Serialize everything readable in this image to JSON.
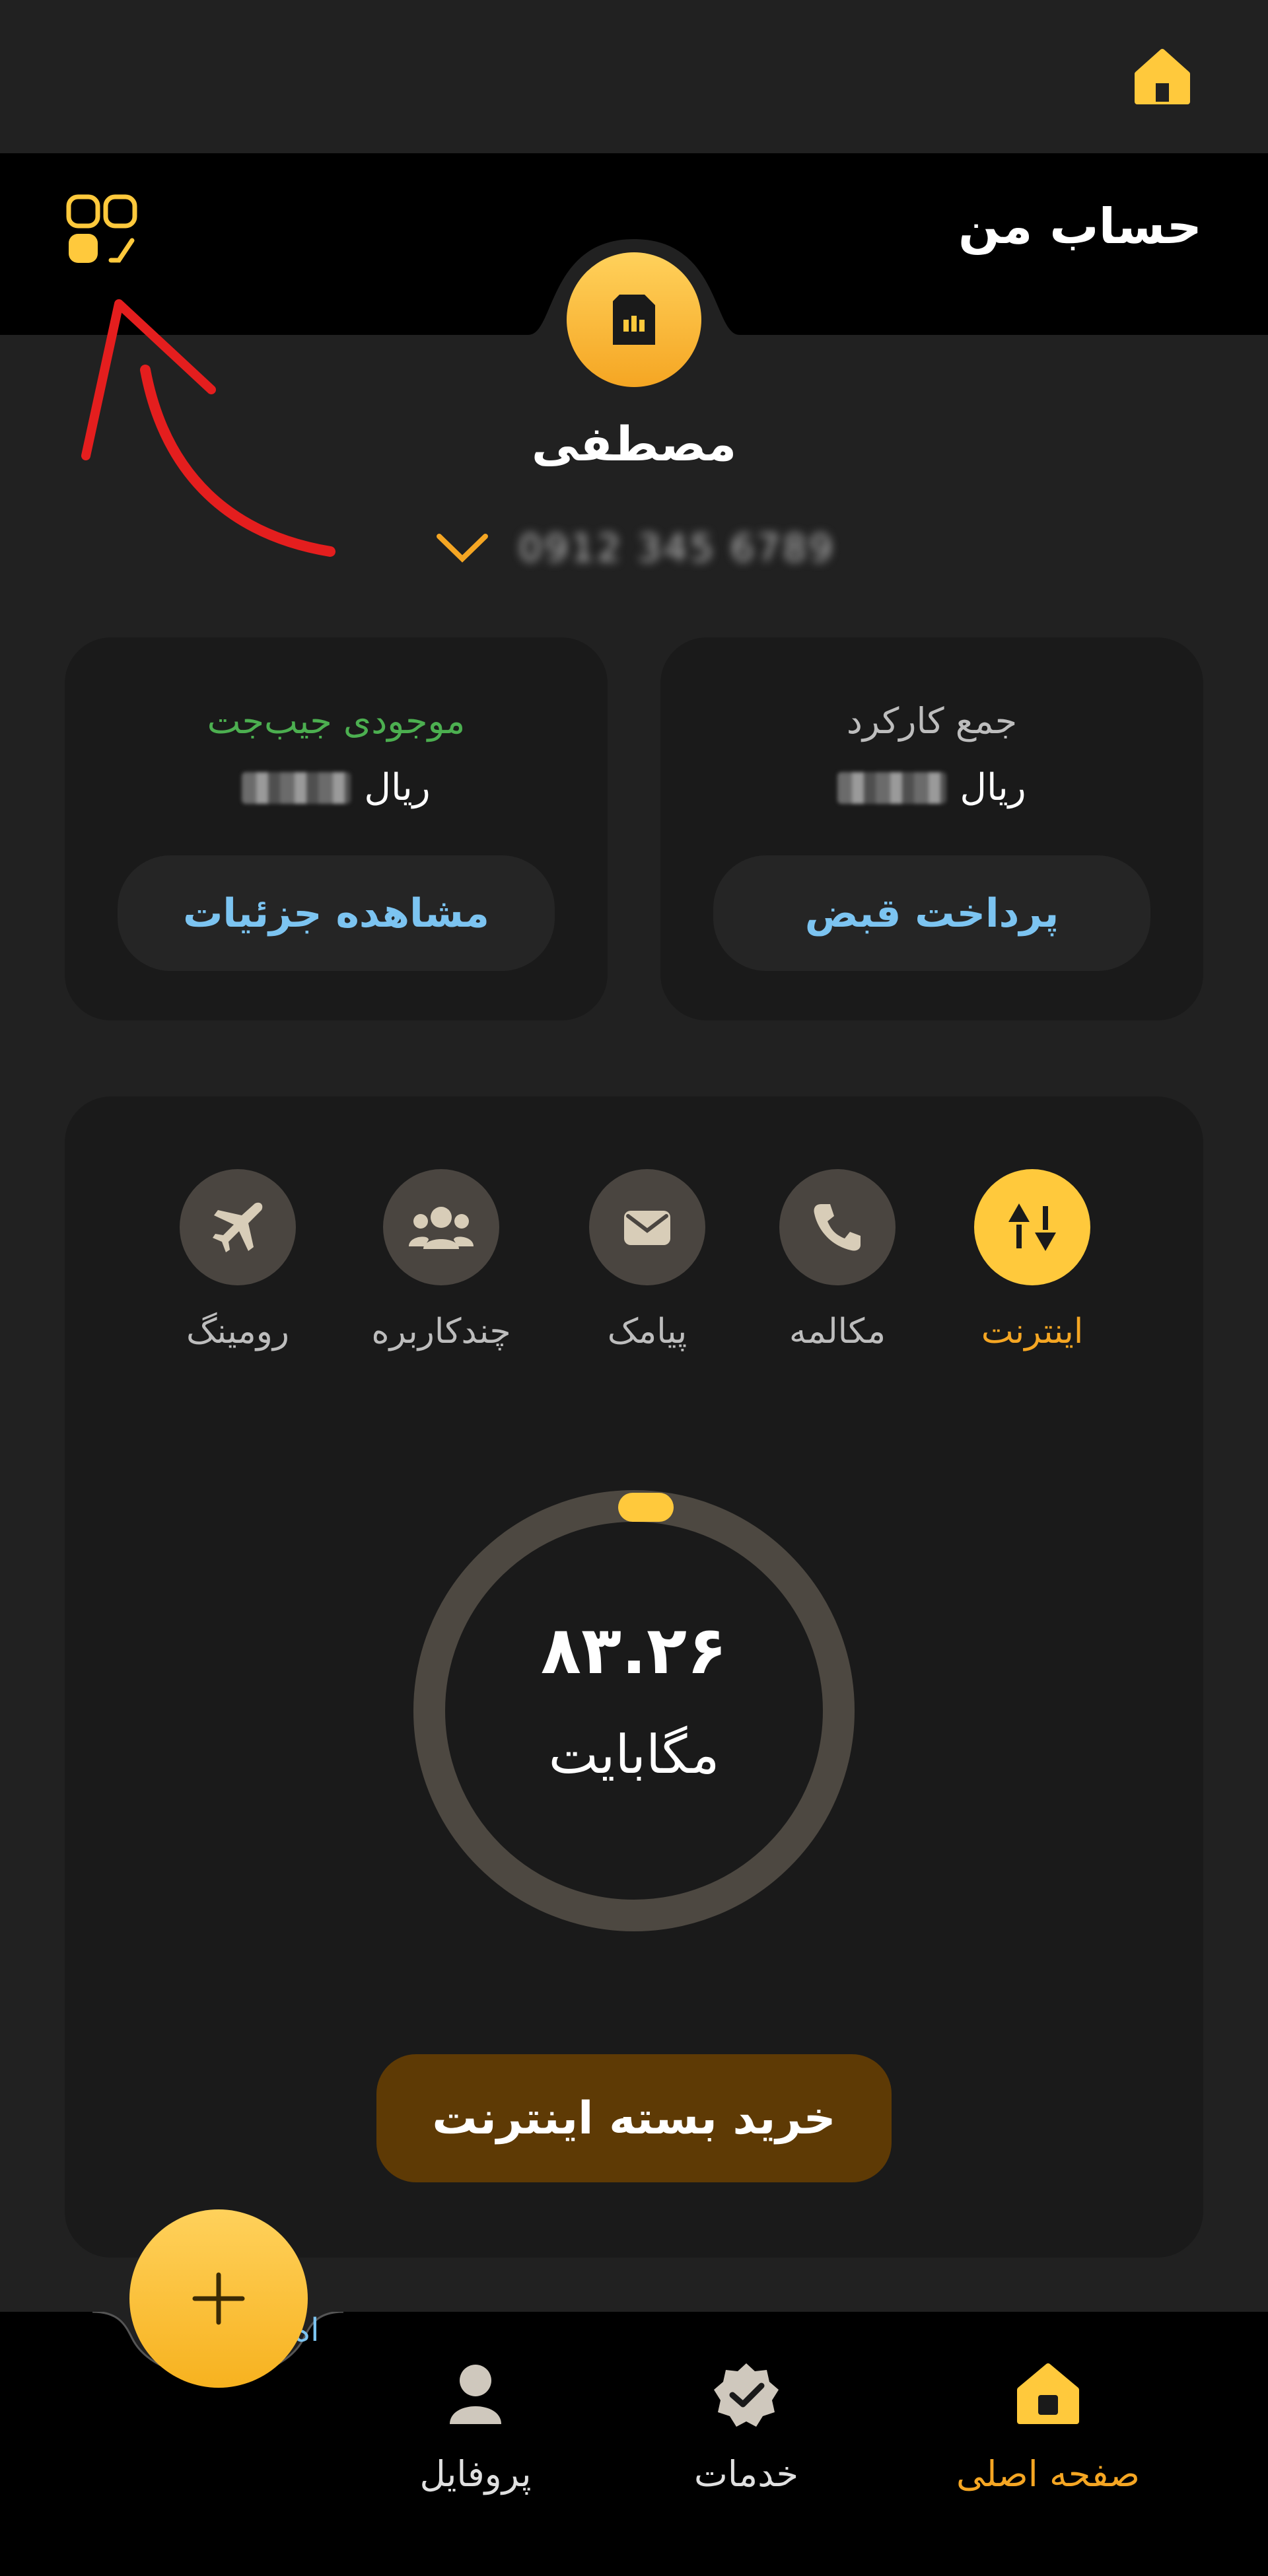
{
  "header": {
    "title": "حساب من"
  },
  "user": {
    "name": "مصطفی",
    "phone": "0912 345 6789"
  },
  "cards": {
    "bill": {
      "title": "جمع کارکرد",
      "currency": "ریال",
      "button": "پرداخت قبض"
    },
    "wallet": {
      "title": "موجودی جیب‌جت",
      "currency": "ریال",
      "button": "مشاهده جزئیات"
    }
  },
  "tabs": [
    {
      "label": "اینترنت",
      "icon": "internet-arrows-icon"
    },
    {
      "label": "مکالمه",
      "icon": "phone-icon"
    },
    {
      "label": "پیامک",
      "icon": "envelope-icon"
    },
    {
      "label": "چندکاربره",
      "icon": "users-icon"
    },
    {
      "label": "رومینگ",
      "icon": "airplane-icon"
    }
  ],
  "usage": {
    "value": "۸۳.۲۶",
    "unit": "مگابایت",
    "fraction": 0.0
  },
  "buy_button": "خرید بسته اینترنت",
  "nav": {
    "home": "صفحه اصلی",
    "services": "خدمات",
    "profile": "پروفایل",
    "partial_label": "اه"
  },
  "colors": {
    "accent": "#ffc93c",
    "link": "#7cc4f1",
    "wallet_title": "#4caf50"
  }
}
